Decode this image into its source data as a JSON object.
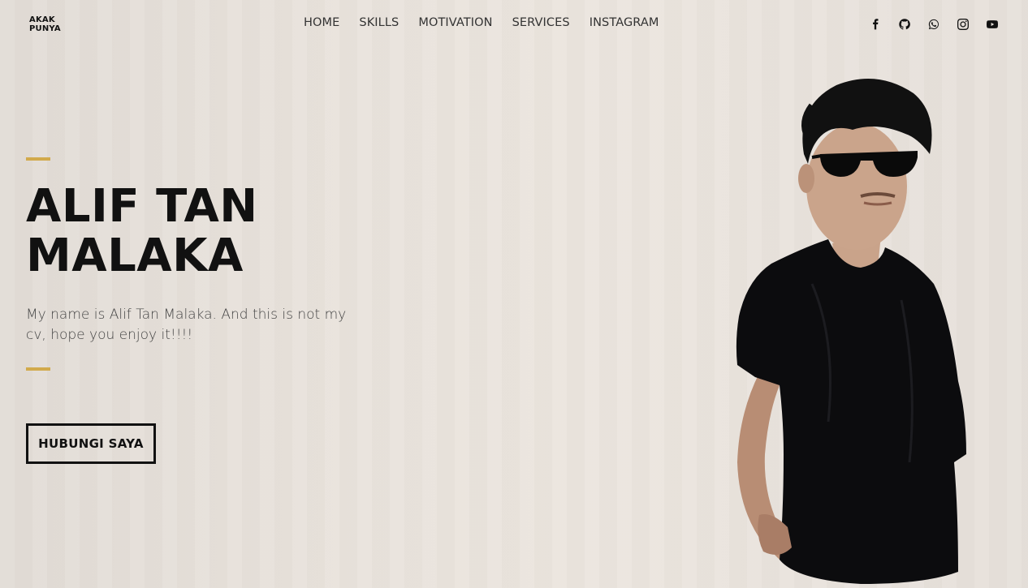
{
  "logo": {
    "line1": "AKAK",
    "line2": "PUNYA"
  },
  "nav": {
    "items": [
      {
        "label": "HOME"
      },
      {
        "label": "SKILLS"
      },
      {
        "label": "MOTIVATION"
      },
      {
        "label": "SERVICES"
      },
      {
        "label": "INSTAGRAM"
      }
    ]
  },
  "social": {
    "icons": [
      "facebook-icon",
      "github-icon",
      "whatsapp-icon",
      "instagram-icon",
      "youtube-icon"
    ]
  },
  "hero": {
    "title_line1": "ALIF TAN",
    "title_line2": "MALAKA",
    "description": "My name is Alif Tan Malaka. And this is not my cv, hope you enjoy it!!!!",
    "cta_label": "HUBUNGI SAYA"
  },
  "colors": {
    "accent": "#d2aa4c",
    "text": "#111111",
    "background": "#e9e3dc"
  }
}
